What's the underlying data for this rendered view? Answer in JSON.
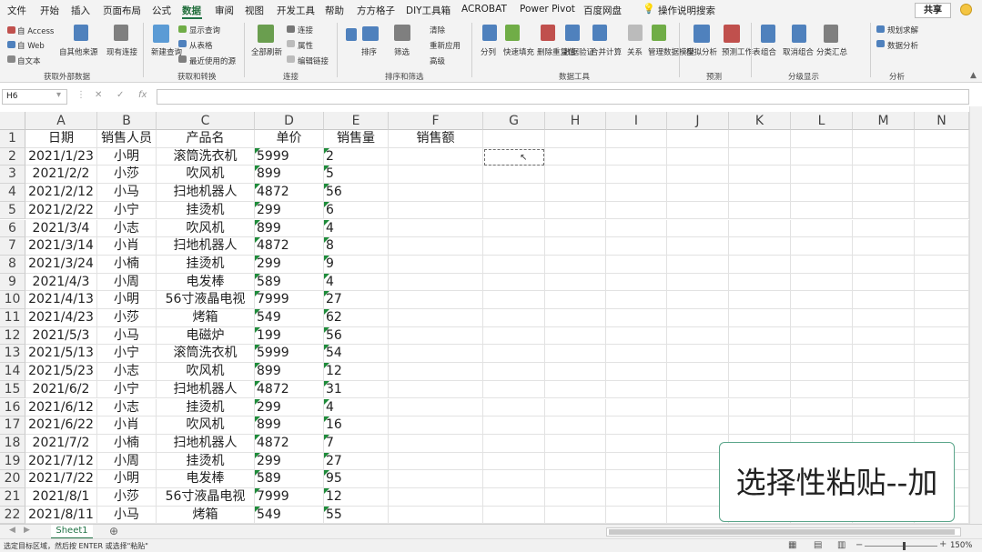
{
  "menu": [
    "文件",
    "开始",
    "插入",
    "页面布局",
    "公式",
    "数据",
    "审阅",
    "视图",
    "开发工具",
    "帮助",
    "方方格子",
    "DIY工具箱",
    "ACROBAT",
    "Power Pivot",
    "百度网盘",
    "操作说明搜索"
  ],
  "active_tab": "数据",
  "share_label": "共享",
  "ribbon": {
    "get_external": {
      "items": [
        "自 Access",
        "自 Web",
        "自文本",
        "自其他来源",
        "现有连接"
      ],
      "group": "获取外部数据"
    },
    "get_transform": {
      "items": [
        "新建查询",
        "显示查询",
        "从表格",
        "最近使用的源"
      ],
      "group": "获取和转换"
    },
    "connections": {
      "items": [
        "全部刷新",
        "连接",
        "属性",
        "编辑链接"
      ],
      "group": "连接"
    },
    "sort_filter": {
      "items": [
        "排序",
        "筛选",
        "清除",
        "重新应用",
        "高级"
      ],
      "group": "排序和筛选"
    },
    "data_tools": {
      "items": [
        "分列",
        "快速填充",
        "删除重复值",
        "数据验证",
        "合并计算",
        "关系",
        "管理数据模型"
      ],
      "group": "数据工具"
    },
    "forecast": {
      "items": [
        "模拟分析",
        "预测工作表"
      ],
      "group": "预测"
    },
    "outline": {
      "items": [
        "组合",
        "取消组合",
        "分类汇总"
      ],
      "group": "分级显示"
    },
    "analysis": {
      "items": [
        "规划求解",
        "数据分析"
      ],
      "group": "分析"
    }
  },
  "namebox": "H6",
  "columns": [
    "A",
    "B",
    "C",
    "D",
    "E",
    "F",
    "G",
    "H",
    "I",
    "J",
    "K",
    "L",
    "M",
    "N"
  ],
  "headers": [
    "日期",
    "销售人员",
    "产品名",
    "单价",
    "销售量",
    "销售额"
  ],
  "rows": [
    [
      "2021/1/23",
      "小明",
      "滚筒洗衣机",
      "5999",
      "2"
    ],
    [
      "2021/2/2",
      "小莎",
      "吹风机",
      "899",
      "5"
    ],
    [
      "2021/2/12",
      "小马",
      "扫地机器人",
      "4872",
      "56"
    ],
    [
      "2021/2/22",
      "小宁",
      "挂烫机",
      "299",
      "6"
    ],
    [
      "2021/3/4",
      "小志",
      "吹风机",
      "899",
      "4"
    ],
    [
      "2021/3/14",
      "小肖",
      "扫地机器人",
      "4872",
      "8"
    ],
    [
      "2021/3/24",
      "小楠",
      "挂烫机",
      "299",
      "9"
    ],
    [
      "2021/4/3",
      "小周",
      "电发棒",
      "589",
      "4"
    ],
    [
      "2021/4/13",
      "小明",
      "56寸液晶电视",
      "7999",
      "27"
    ],
    [
      "2021/4/23",
      "小莎",
      "烤箱",
      "549",
      "62"
    ],
    [
      "2021/5/3",
      "小马",
      "电磁炉",
      "199",
      "56"
    ],
    [
      "2021/5/13",
      "小宁",
      "滚筒洗衣机",
      "5999",
      "54"
    ],
    [
      "2021/5/23",
      "小志",
      "吹风机",
      "899",
      "12"
    ],
    [
      "2021/6/2",
      "小宁",
      "扫地机器人",
      "4872",
      "31"
    ],
    [
      "2021/6/12",
      "小志",
      "挂烫机",
      "299",
      "4"
    ],
    [
      "2021/6/22",
      "小肖",
      "吹风机",
      "899",
      "16"
    ],
    [
      "2021/7/2",
      "小楠",
      "扫地机器人",
      "4872",
      "7"
    ],
    [
      "2021/7/12",
      "小周",
      "挂烫机",
      "299",
      "27"
    ],
    [
      "2021/7/22",
      "小明",
      "电发棒",
      "589",
      "95"
    ],
    [
      "2021/8/1",
      "小莎",
      "56寸液晶电视",
      "7999",
      "12"
    ],
    [
      "2021/8/11",
      "小马",
      "烤箱",
      "549",
      "55"
    ]
  ],
  "sheet_tab": "Sheet1",
  "status_text": "选定目标区域，然后按 ENTER 或选择\"粘贴\"",
  "zoom": "150%",
  "caption": "选择性粘贴--加",
  "colors": {
    "accent": "#217346",
    "caption_border": "#5aa58a",
    "triangle": "#1e8b3a"
  }
}
